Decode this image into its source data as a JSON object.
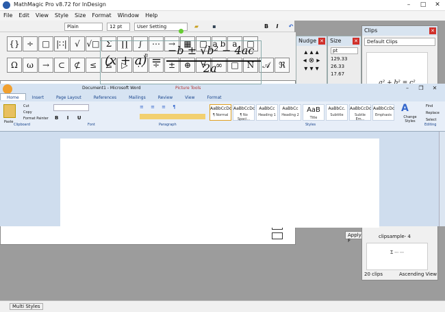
{
  "mm": {
    "title": "MathMagic Pro v8.72 for InDesign",
    "menu": [
      "File",
      "Edit",
      "View",
      "Style",
      "Size",
      "Format",
      "Window",
      "Help"
    ],
    "toolbar": {
      "font": "Plain",
      "size": "12 pt",
      "setting": "User Setting"
    },
    "palette_row1": [
      "{}",
      "÷",
      "□",
      "|∷|",
      "√",
      "√□",
      "Σ",
      "∏",
      "∫",
      "⋯",
      "→",
      "▦",
      "□",
      "a b",
      "a",
      "□"
    ],
    "palette_row2": [
      "Ω",
      "ω",
      "→",
      "⊂",
      "⊄",
      "≤",
      "≰",
      "▷",
      "∴",
      "÷",
      "±",
      "⊕",
      "∀",
      "∞",
      "□",
      "N",
      "𝒜",
      "ℜ"
    ],
    "status": "Multi Styles"
  },
  "nudge": {
    "title": "Nudge"
  },
  "size": {
    "title": "Size",
    "unit": "pt",
    "values": [
      "129.33",
      "26.33",
      "17.67"
    ]
  },
  "clips": {
    "title": "Clips",
    "dropdown": "Default Clips",
    "formula": "a² + b² = c²",
    "sample_label": "clipsample- 4",
    "count": "20 clips",
    "sort": "Ascending View"
  },
  "apply_label": "Apply F",
  "word": {
    "title": "Document1 - Microsoft Word",
    "context_tab": "Picture Tools",
    "tabs": [
      "Home",
      "Insert",
      "Page Layout",
      "References",
      "Mailings",
      "Review",
      "View",
      "Format"
    ],
    "clipboard": {
      "paste": "Paste",
      "cut": "Cut",
      "copy": "Copy",
      "format_painter": "Format Painter",
      "label": "Clipboard"
    },
    "font_label": "Font",
    "paragraph_label": "Paragraph",
    "styles_label": "Styles",
    "editing_label": "Editing",
    "styles": [
      {
        "preview": "AaBbCcDc",
        "name": "¶ Normal"
      },
      {
        "preview": "AaBbCcDc",
        "name": "¶ No Spaci..."
      },
      {
        "preview": "AaBbCc",
        "name": "Heading 1"
      },
      {
        "preview": "AaBbCc",
        "name": "Heading 2"
      },
      {
        "preview": "AaB",
        "name": "Title"
      },
      {
        "preview": "AaBbCc.",
        "name": "Subtitle"
      },
      {
        "preview": "AaBbCcDc",
        "name": "Subtle Em..."
      },
      {
        "preview": "AaBbCcDc",
        "name": "Emphasis"
      }
    ],
    "change_styles": "Change Styles",
    "find": "Find",
    "replace": "Replace",
    "select": "Select"
  },
  "equation": {
    "lhs": "(x + a)",
    "exp": "n",
    "num": "−b ± √b² − 4ac",
    "den": "2a"
  }
}
